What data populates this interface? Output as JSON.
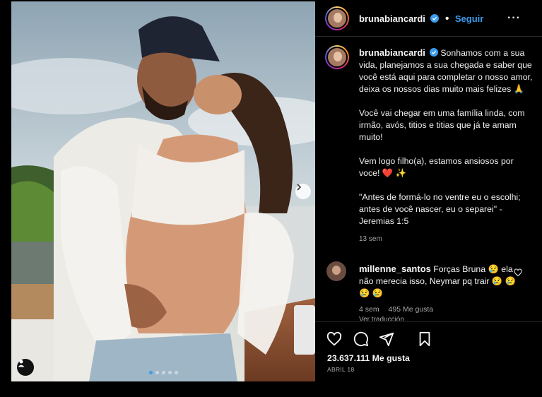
{
  "post": {
    "username": "brunabiancardi",
    "follow_label": "Seguir",
    "more_label": "···"
  },
  "caption": {
    "username": "brunabiancardi",
    "paragraphs": [
      "Sonhamos com a sua vida, planejamos a sua chegada e saber que você está aqui para completar o nosso amor, deixa os nossos dias muito mais felizes 🙏",
      "Você vai chegar em uma família linda, com irmão, avós, titios e titias que já te amam muito!",
      "Vem logo filho(a), estamos ansiosos por voce! ❤️ ✨",
      "\"Antes de formá-lo no ventre eu o escolhi; antes de você nascer, eu o separei\" - Jeremias 1:5"
    ],
    "time": "13 sem"
  },
  "comment": {
    "username": "millenne_santos",
    "text": "Forças Bruna 😢 ela não merecia isso, Neymar pq trair 😢 😢 😢 😢",
    "time": "4 sem",
    "likes": "495 Me gusta",
    "translate": "Ver traducción"
  },
  "footer": {
    "likes": "23.637.111 Me gusta",
    "date": "ABRIL 18"
  },
  "carousel": {
    "current": 1,
    "total": 5
  },
  "colors": {
    "accent": "#3b9cf0",
    "background": "#000000",
    "muted": "#a8a8a8"
  },
  "icons": [
    "user-tag-icon",
    "chevron-right-icon",
    "verified-badge-icon",
    "heart-icon",
    "comment-icon",
    "share-icon",
    "bookmark-icon",
    "more-options-icon"
  ]
}
